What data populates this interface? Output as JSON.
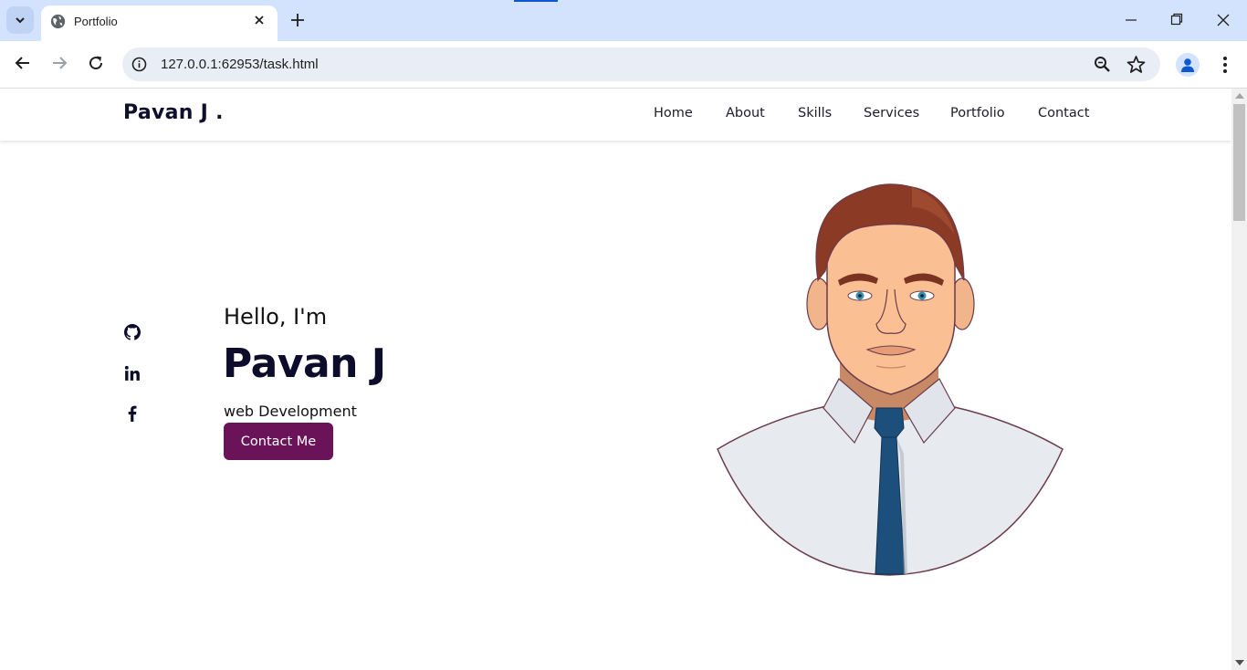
{
  "browser": {
    "tab_title": "Portfolio",
    "url": "127.0.0.1:62953/task.html"
  },
  "site": {
    "logo": "Pavan J .",
    "nav": [
      "Home",
      "About",
      "Skills",
      "Services",
      "Portfolio",
      "Contact"
    ]
  },
  "hero": {
    "greeting": "Hello, I'm",
    "name": "Pavan J",
    "role": "web Development",
    "button_label": "Contact Me",
    "social_icons": [
      "github-icon",
      "linkedin-icon",
      "facebook-icon"
    ]
  },
  "colors": {
    "tabbar": "#d3e3fd",
    "button": "#6b1358",
    "heading": "#0d0d2b"
  }
}
